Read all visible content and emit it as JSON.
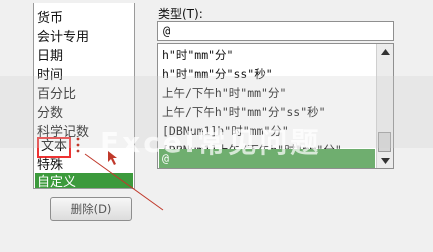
{
  "category_list": {
    "items": [
      "货币",
      "会计专用",
      "日期",
      "时间",
      "百分比",
      "分数",
      "科学记数",
      "文本",
      "特殊",
      "自定义"
    ],
    "selected_index": 9,
    "highlighted_index": 7
  },
  "type_section": {
    "label": "类型(T):",
    "value": "@",
    "formats": [
      "h\"时\"mm\"分\"",
      "h\"时\"mm\"分\"ss\"秒\"",
      "上午/下午h\"时\"mm\"分\"",
      "上午/下午h\"时\"mm\"分\"ss\"秒\"",
      "[DBNum1]h\"时\"mm\"分\"",
      "[DBNum1]上午/下午h\"时\"mm\"分\"",
      "@"
    ],
    "selected_format_index": 6
  },
  "delete_button": {
    "label": "删除(D)"
  },
  "watermark": {
    "text": "Excel常见问题"
  },
  "colors": {
    "selection": "#3c9a3c",
    "highlight": "#e33333",
    "annotation": "#c0392b"
  }
}
